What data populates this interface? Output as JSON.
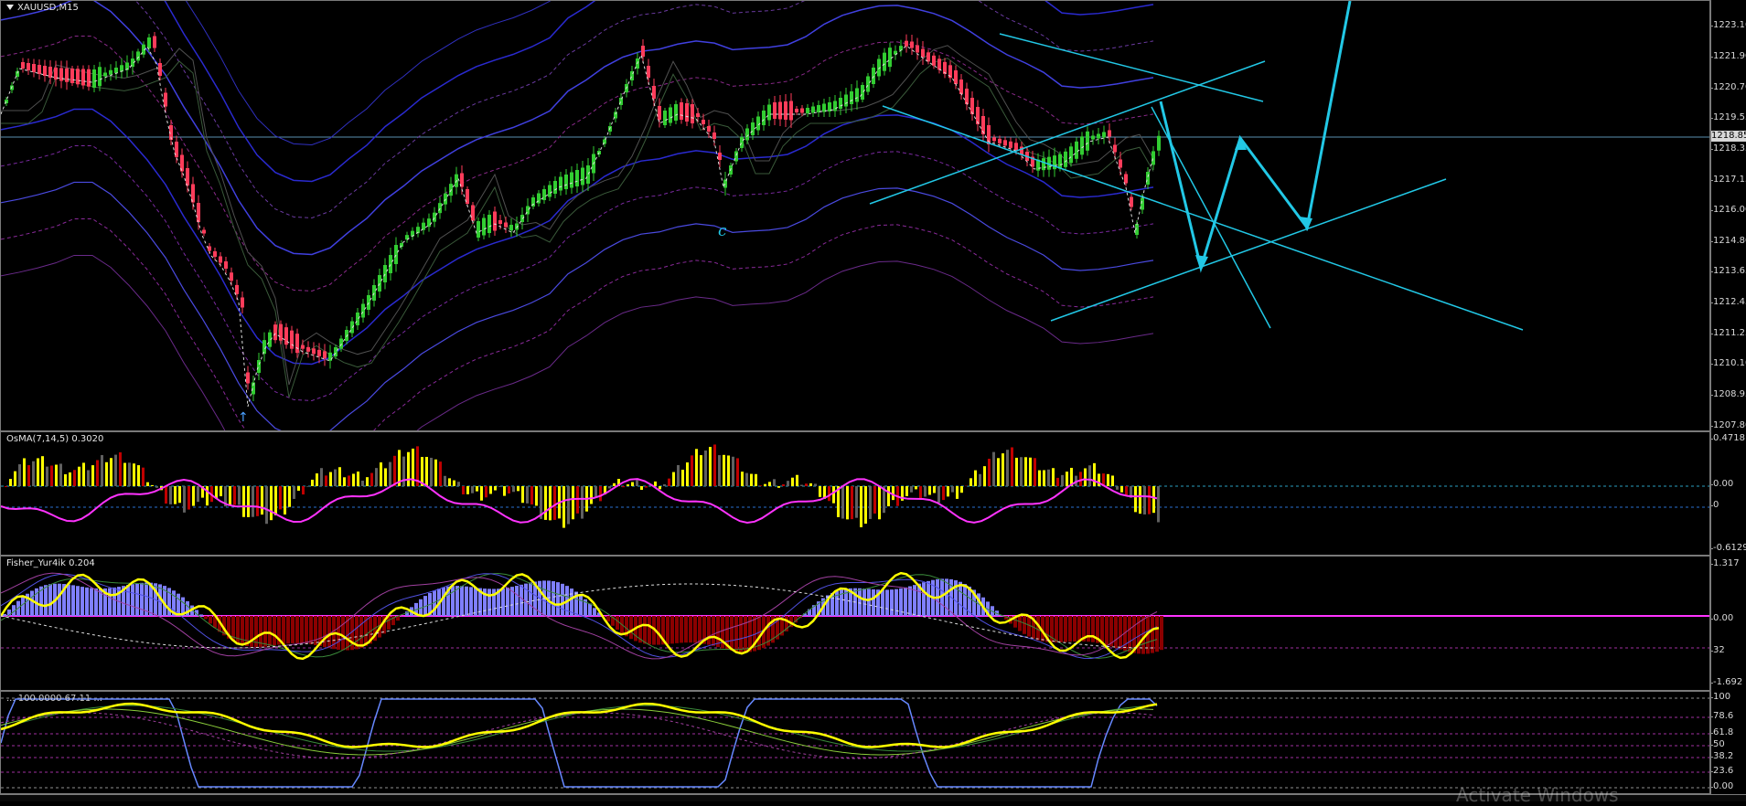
{
  "main_chart": {
    "title": "XAUUSD,M15",
    "current_price": "1218.85",
    "axis_ticks": [
      "1223.10",
      "1221.90",
      "1220.70",
      "1219.55",
      "1218.35",
      "1217.15",
      "1216.00",
      "1214.80",
      "1213.65",
      "1212.45",
      "1211.25",
      "1210.10",
      "1208.95",
      "1207.80"
    ],
    "annotation": "c"
  },
  "osma": {
    "label": "OsMA(7,14,5) 0.3020",
    "axis_ticks": [
      "0.4718",
      "0.00",
      "0",
      "-0.6129"
    ]
  },
  "fisher": {
    "label": "Fisher_Yur4ik 0.204",
    "axis_ticks": [
      "1.317",
      "0.00",
      "32",
      "-1.692"
    ]
  },
  "rsi": {
    "label": "... 100.0000 67.11 ...",
    "axis_ticks": [
      "100",
      "78.6",
      "61.8",
      "50",
      "38.2",
      "23.6",
      "0.00"
    ]
  },
  "watermark": "Activate Windows",
  "colors": {
    "bull_candle": "#32cd32",
    "bear_candle": "#ff3c5a",
    "channel_lines": "#22c8e6",
    "osma_line": "#ff33ff",
    "osma_bars": "#ffff00",
    "fisher_line": "#ffff00",
    "fisher_hist_up": "#7f7fff",
    "fisher_hist_down": "#8b0000",
    "rsi_blue": "#6688ff"
  }
}
